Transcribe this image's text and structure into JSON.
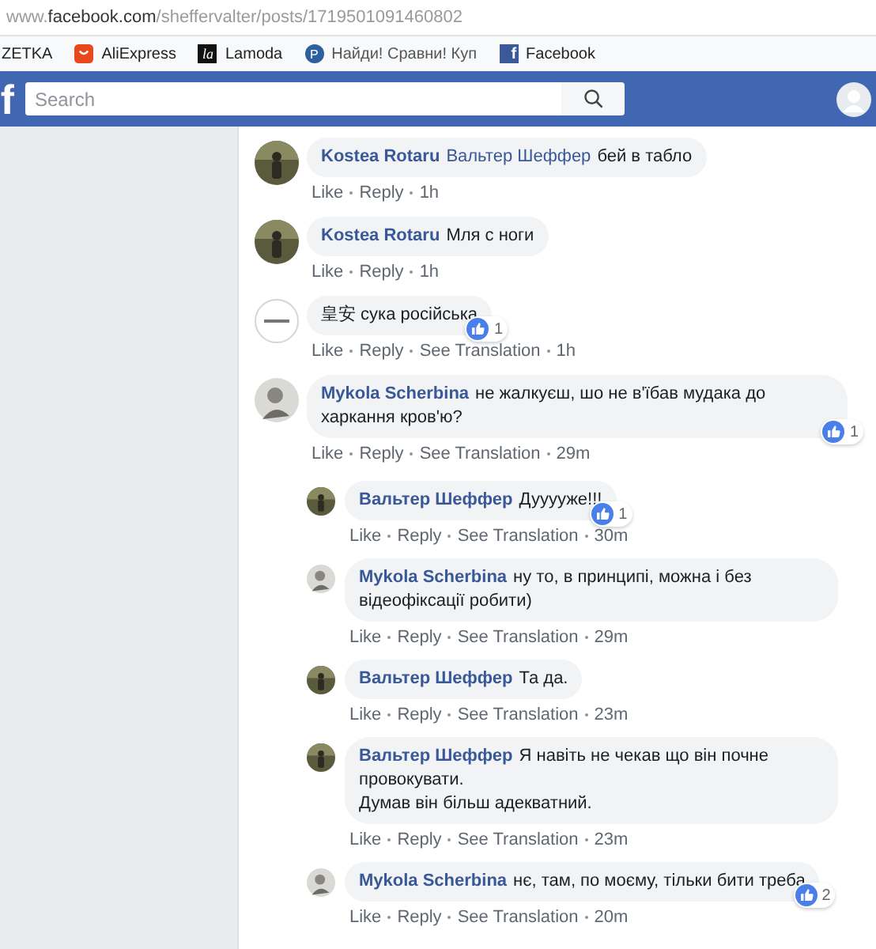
{
  "address_bar": {
    "prefix": "www.",
    "host": "facebook.com",
    "path": "/sheffervalter/posts/1719501091460802"
  },
  "bookmarks": [
    {
      "kind": "plain",
      "label": "ZETKA"
    },
    {
      "kind": "aliexpress",
      "label": "AliExpress"
    },
    {
      "kind": "lamoda",
      "label": "Lamoda",
      "icon_text": "la"
    },
    {
      "kind": "compare",
      "label": "Найди! Сравни! Куп",
      "icon_text": "P"
    },
    {
      "kind": "facebook",
      "label": "Facebook",
      "icon_text": "f"
    }
  ],
  "top_bar": {
    "logo": "f",
    "search": {
      "placeholder": "Search"
    }
  },
  "comments": [
    {
      "avatar": {
        "kind": "photo"
      },
      "author": "Kostea Rotaru",
      "mention": "Вальтер Шеффер",
      "text": "бей в табло",
      "actions": [
        "Like",
        "Reply"
      ],
      "time": "1h"
    },
    {
      "avatar": {
        "kind": "photo"
      },
      "author": "Kostea Rotaru",
      "text": "Мля с ноги",
      "actions": [
        "Like",
        "Reply"
      ],
      "time": "1h"
    },
    {
      "avatar": {
        "kind": "logo"
      },
      "text": "皇安 сука російська",
      "reactions": "1",
      "actions": [
        "Like",
        "Reply",
        "See Translation"
      ],
      "time": "1h"
    },
    {
      "avatar": {
        "kind": "person"
      },
      "author": "Mykola Scherbina",
      "text": "не жалкуєш, шо не в'їбав мудака до харкання кров'ю?",
      "reactions": "1",
      "actions": [
        "Like",
        "Reply",
        "See Translation"
      ],
      "time": "29m",
      "children": [
        {
          "avatar": {
            "kind": "photo"
          },
          "author": "Вальтер Шеффер",
          "text": "Дууууже!!!",
          "reactions": "1",
          "actions": [
            "Like",
            "Reply",
            "See Translation"
          ],
          "time": "30m"
        },
        {
          "avatar": {
            "kind": "person"
          },
          "author": "Mykola Scherbina",
          "text": "ну то, в принципі, можна і без відеофіксації робити)",
          "actions": [
            "Like",
            "Reply",
            "See Translation"
          ],
          "time": "29m"
        },
        {
          "avatar": {
            "kind": "photo"
          },
          "author": "Вальтер Шеффер",
          "text": "Та да.",
          "actions": [
            "Like",
            "Reply",
            "See Translation"
          ],
          "time": "23m"
        },
        {
          "avatar": {
            "kind": "photo"
          },
          "author": "Вальтер Шеффер",
          "text": "Я навіть не чекав що він почне провокувати.\nДумав він більш адекватний.",
          "actions": [
            "Like",
            "Reply",
            "See Translation"
          ],
          "time": "23m"
        },
        {
          "avatar": {
            "kind": "person"
          },
          "author": "Mykola Scherbina",
          "text": "нє, там, по моєму, тільки бити треба",
          "reactions": "2",
          "actions": [
            "Like",
            "Reply",
            "See Translation"
          ],
          "time": "20m"
        }
      ]
    }
  ]
}
